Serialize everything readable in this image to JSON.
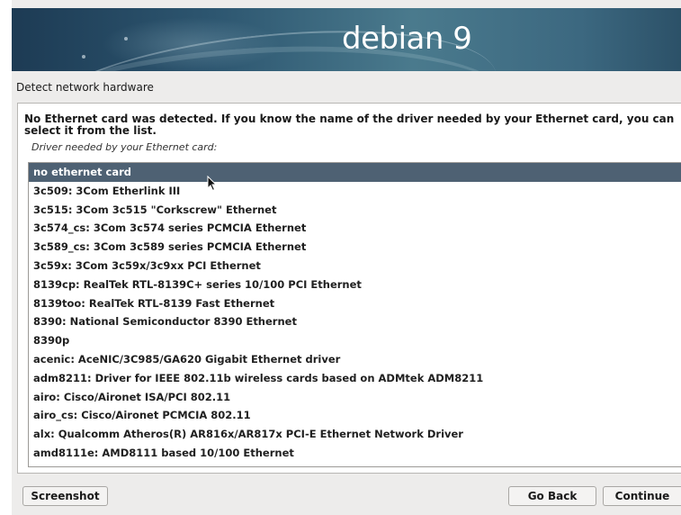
{
  "banner": {
    "title": "debian 9"
  },
  "step_title": "Detect network hardware",
  "message": "No Ethernet card was detected. If you know the name of the driver needed by your Ethernet card, you can select it from the list.",
  "driver_label": "Driver needed by your Ethernet card:",
  "driver_list": {
    "selected_index": 0,
    "items": [
      "no ethernet card",
      "3c509: 3Com Etherlink III",
      "3c515: 3Com 3c515 \"Corkscrew\" Ethernet",
      "3c574_cs: 3Com 3c574 series PCMCIA Ethernet",
      "3c589_cs: 3Com 3c589 series PCMCIA Ethernet",
      "3c59x: 3Com 3c59x/3c9xx PCI Ethernet",
      "8139cp: RealTek RTL-8139C+ series 10/100 PCI Ethernet",
      "8139too: RealTek RTL-8139 Fast Ethernet",
      "8390: National Semiconductor 8390 Ethernet",
      "8390p",
      "acenic: AceNIC/3C985/GA620 Gigabit Ethernet driver",
      "adm8211: Driver for IEEE 802.11b wireless cards based on ADMtek ADM8211",
      "airo: Cisco/Aironet ISA/PCI 802.11",
      "airo_cs: Cisco/Aironet PCMCIA 802.11",
      "alx: Qualcomm Atheros(R) AR816x/AR817x PCI-E Ethernet Network Driver",
      "amd8111e: AMD8111 based 10/100 Ethernet"
    ]
  },
  "buttons": {
    "screenshot": "Screenshot",
    "go_back": "Go Back",
    "continue": "Continue"
  },
  "colors": {
    "selection": "#4e6173",
    "window_bg": "#edeceb",
    "banner_dark": "#1d3b54",
    "banner_light": "#4a7a8d"
  },
  "icons": {
    "cursor": "mouse-pointer-icon"
  }
}
